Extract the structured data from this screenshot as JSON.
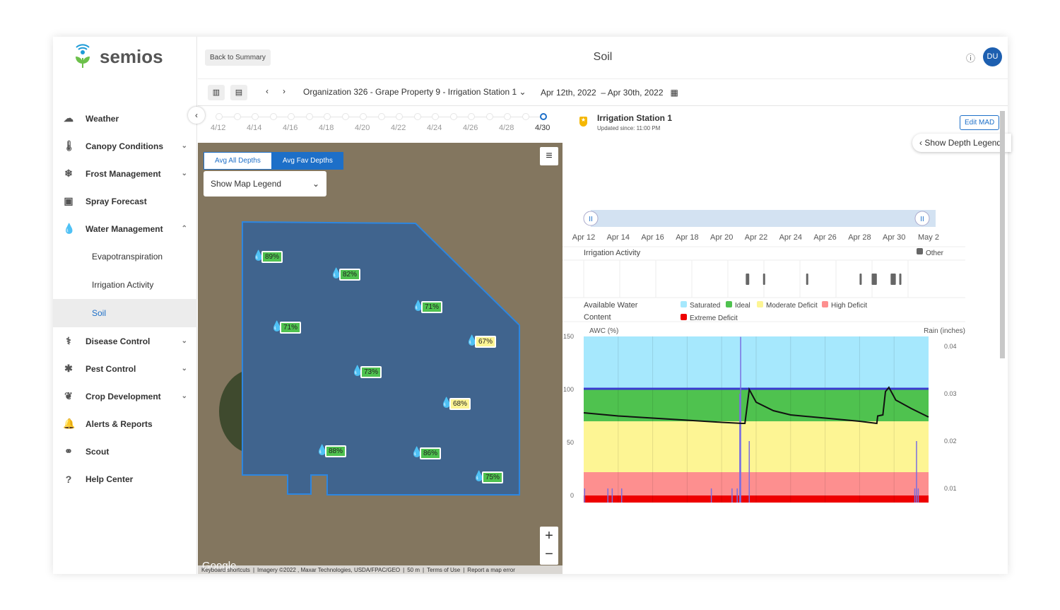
{
  "app": {
    "brand": "semios",
    "title": "Soil",
    "help_icon": "question-circle-icon",
    "user_initials": "DU",
    "accent": "#1d5fb0"
  },
  "sidebar": {
    "items": [
      {
        "label": "Weather",
        "icon": "cloud-icon",
        "chevron": ""
      },
      {
        "label": "Canopy Conditions",
        "icon": "thermometer-icon",
        "chevron": "⌄"
      },
      {
        "label": "Frost Management",
        "icon": "snowflake-icon",
        "chevron": "⌄"
      },
      {
        "label": "Spray Forecast",
        "icon": "calendar-icon",
        "chevron": ""
      },
      {
        "label": "Water Management",
        "icon": "droplet-icon",
        "chevron": "⌃"
      }
    ],
    "sub_items": [
      "Evapotranspiration",
      "Irrigation Activity",
      "Soil"
    ],
    "items2": [
      {
        "label": "Disease Control",
        "icon": "stethoscope-icon",
        "chevron": "⌄"
      },
      {
        "label": "Pest Control",
        "icon": "bug-icon",
        "chevron": "⌄"
      },
      {
        "label": "Crop Development",
        "icon": "leaf-icon",
        "chevron": "⌄"
      },
      {
        "label": "Alerts & Reports",
        "icon": "bell-icon",
        "chevron": ""
      },
      {
        "label": "Scout",
        "icon": "binoculars-icon",
        "chevron": ""
      },
      {
        "label": "Help Center",
        "icon": "question-circle-icon",
        "chevron": ""
      }
    ]
  },
  "toolbar": {
    "back_label": "Back to Summary",
    "location": "Organization 326 - Grape Property 9 - Irrigation Station 1",
    "date_start": "Apr 12th, 2022",
    "date_sep": "–",
    "date_end": "Apr 30th, 2022"
  },
  "timeline": {
    "labels": [
      "4/12",
      "4/14",
      "4/16",
      "4/18",
      "4/20",
      "4/22",
      "4/24",
      "4/26",
      "4/28",
      "4/30"
    ],
    "selected": "4/30"
  },
  "map": {
    "tabs": [
      "Avg All Depths",
      "Avg Fav Depths"
    ],
    "active_tab": "Avg Fav Depths",
    "legend_select": "Show Map Legend",
    "markers": [
      {
        "v": "89%",
        "c": "green"
      },
      {
        "v": "82%",
        "c": "green"
      },
      {
        "v": "71%",
        "c": "green"
      },
      {
        "v": "71%",
        "c": "green"
      },
      {
        "v": "67%",
        "c": "yellow"
      },
      {
        "v": "73%",
        "c": "green"
      },
      {
        "v": "68%",
        "c": "yellow"
      },
      {
        "v": "88%",
        "c": "green"
      },
      {
        "v": "86%",
        "c": "green"
      },
      {
        "v": "75%",
        "c": "green"
      }
    ],
    "google": "Google",
    "footer": [
      "Keyboard shortcuts",
      "Imagery ©2022 , Maxar Technologies, USDA/FPAC/GEO",
      "50 m",
      "Terms of Use",
      "Report a map error"
    ],
    "zoom_in": "+",
    "zoom_out": "−"
  },
  "station": {
    "name": "Irrigation Station 1",
    "updated": "Updated since: 11:00 PM",
    "edit_label": "Edit MAD",
    "depth_legend": "Show Depth Legend"
  },
  "range_labels": [
    "Apr 12",
    "Apr 14",
    "Apr 16",
    "Apr 18",
    "Apr 20",
    "Apr 22",
    "Apr 24",
    "Apr 26",
    "Apr 28",
    "Apr 30",
    "May 2"
  ],
  "irrigation": {
    "title": "Irrigation Activity",
    "legend": "Other",
    "events": [
      [
        21.4,
        21.6
      ],
      [
        22.4,
        22.5
      ],
      [
        24.9,
        24.95
      ],
      [
        28.0,
        28.05
      ],
      [
        28.7,
        29.0
      ],
      [
        29.8,
        30.1
      ],
      [
        30.3,
        30.35
      ]
    ]
  },
  "awc_legend": {
    "title1": "Available Water",
    "title2": "Content",
    "items": [
      {
        "label": "Saturated",
        "color": "#a6e8fd"
      },
      {
        "label": "Ideal",
        "color": "#4fc24f"
      },
      {
        "label": "Moderate Deficit",
        "color": "#fdf594"
      },
      {
        "label": "High Deficit",
        "color": "#fd8f8f"
      },
      {
        "label": "Extreme Deficit",
        "color": "#ee0000"
      }
    ]
  },
  "chart_data": {
    "type": "line",
    "x_start": "Apr 12",
    "x_end": "May 2",
    "ylabel": "AWC (%)",
    "y2label": "Rain (inches)",
    "yticks": [
      150,
      100,
      50,
      0
    ],
    "ylim": [
      -32,
      150
    ],
    "y2ticks": [
      0.04,
      0.03,
      0.02,
      0.01
    ],
    "y2lim": [
      0,
      0.042
    ],
    "bands": [
      {
        "name": "Saturated",
        "from": 101,
        "to": 150
      },
      {
        "name": "Ideal",
        "from": 70,
        "to": 101
      },
      {
        "name": "Moderate Deficit",
        "from": 22,
        "to": 70
      },
      {
        "name": "High Deficit",
        "from": 0,
        "to": 22
      },
      {
        "name": "Extreme Deficit",
        "from": -32,
        "to": 0
      }
    ],
    "awc": [
      [
        0,
        78
      ],
      [
        2,
        75
      ],
      [
        4,
        73
      ],
      [
        6,
        71
      ],
      [
        8,
        69
      ],
      [
        9.2,
        68
      ],
      [
        9.35,
        68
      ],
      [
        9.6,
        100
      ],
      [
        10,
        88
      ],
      [
        11,
        80
      ],
      [
        12,
        76
      ],
      [
        14,
        73
      ],
      [
        16,
        70
      ],
      [
        17,
        68
      ],
      [
        17.05,
        75
      ],
      [
        17.35,
        76
      ],
      [
        17.5,
        98
      ],
      [
        17.7,
        102
      ],
      [
        18.1,
        90
      ],
      [
        19,
        82
      ],
      [
        20,
        74
      ]
    ],
    "rain": [
      [
        0.05,
        0.01
      ],
      [
        1.4,
        0.01
      ],
      [
        1.65,
        0.01
      ],
      [
        2.2,
        0.01
      ],
      [
        7.4,
        0.01
      ],
      [
        8.6,
        0.01
      ],
      [
        8.9,
        0.01
      ],
      [
        9.05,
        0.03
      ],
      [
        9.1,
        0.042
      ],
      [
        9.6,
        0.02
      ],
      [
        19.2,
        0.01
      ],
      [
        19.3,
        0.02
      ],
      [
        19.4,
        0.01
      ]
    ]
  }
}
